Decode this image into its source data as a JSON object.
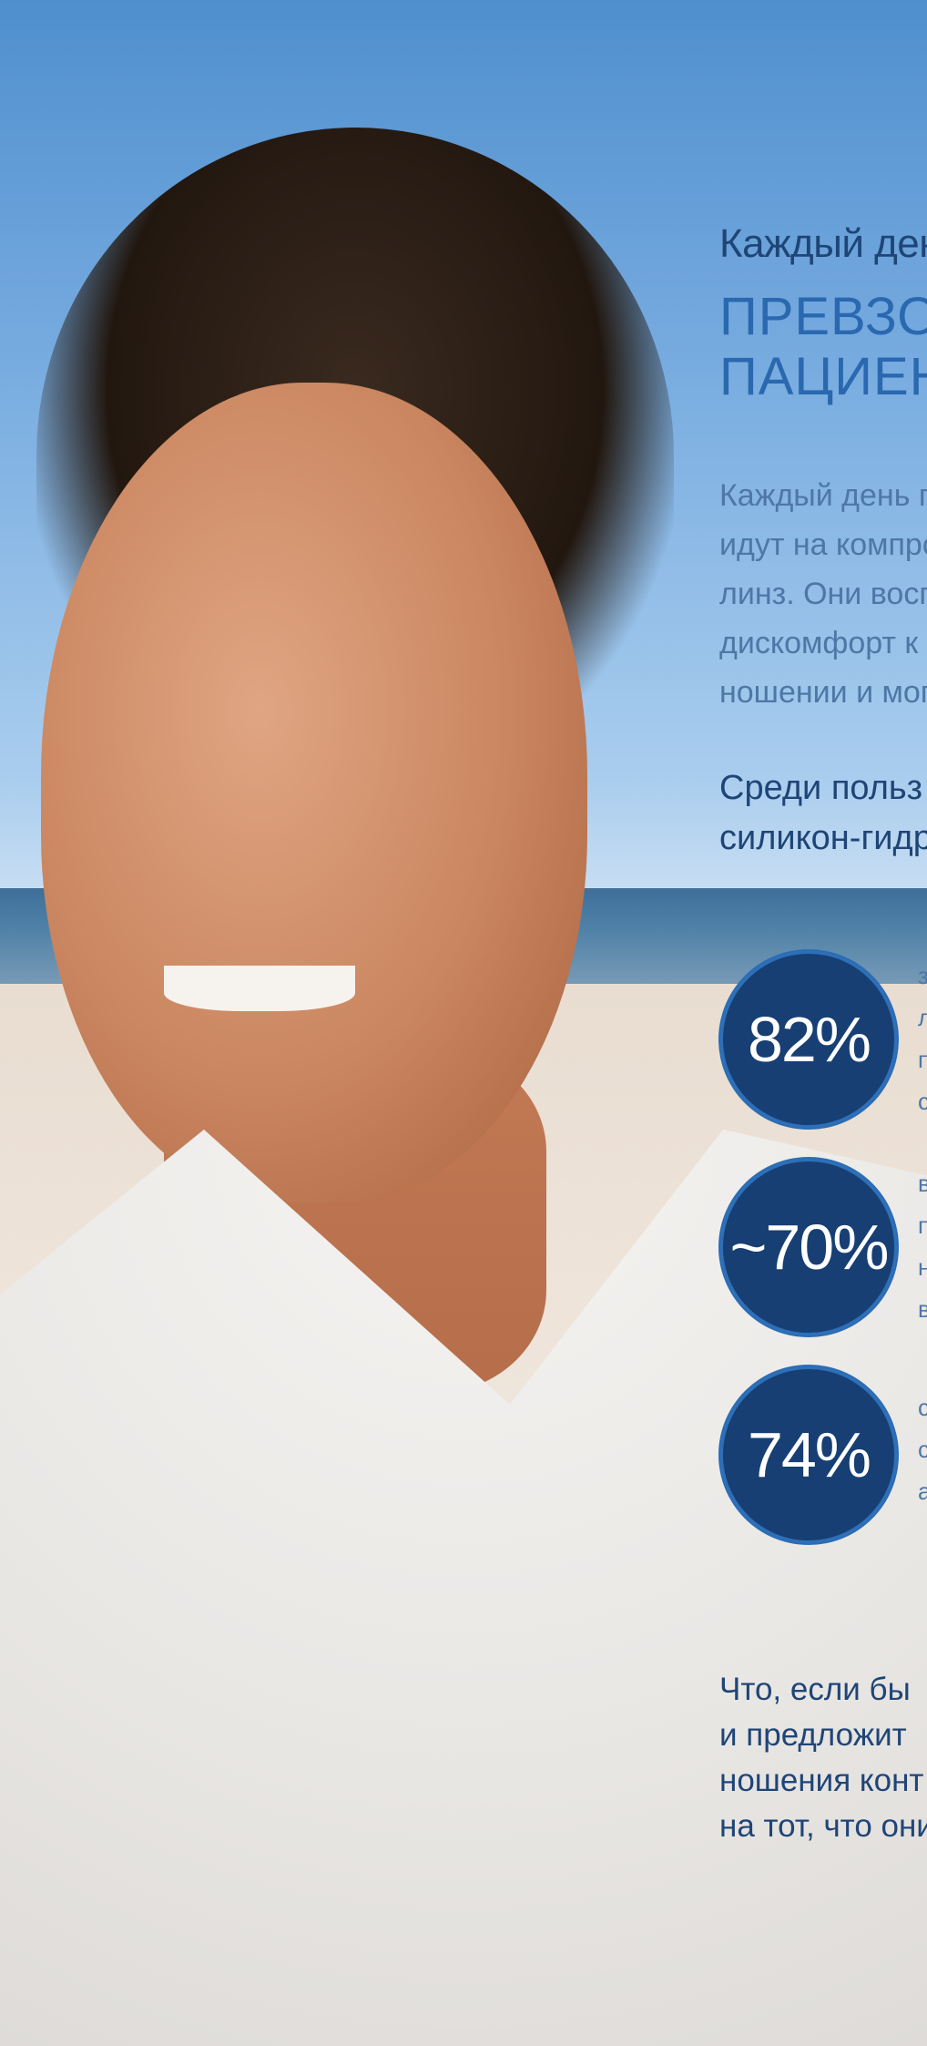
{
  "kicker": "Каждый ден",
  "headline": [
    "ПРЕВЗО",
    "ПАЦИЕН"
  ],
  "body_lines": [
    "Каждый день п",
    "идут на компро",
    "линз. Они восп",
    "дискомфорт к",
    "ношении и мог"
  ],
  "subheading_lines": [
    "Среди польз",
    "силикон-гидр"
  ],
  "stats": [
    {
      "value": "82%",
      "side_text": [
        "з",
        "л",
        "п",
        "с"
      ]
    },
    {
      "value": "~70%",
      "side_text": [
        "в",
        "п",
        "н",
        "в"
      ]
    },
    {
      "value": "74%",
      "side_text": [
        "с",
        "с",
        "а"
      ]
    }
  ],
  "closing_lines": [
    "Что, если бы",
    "и предложит",
    "ношения конт",
    "на тот, что они"
  ],
  "colors": {
    "dark_blue": "#1f4577",
    "accent_blue": "#2a68b0",
    "badge": "#173f73"
  }
}
